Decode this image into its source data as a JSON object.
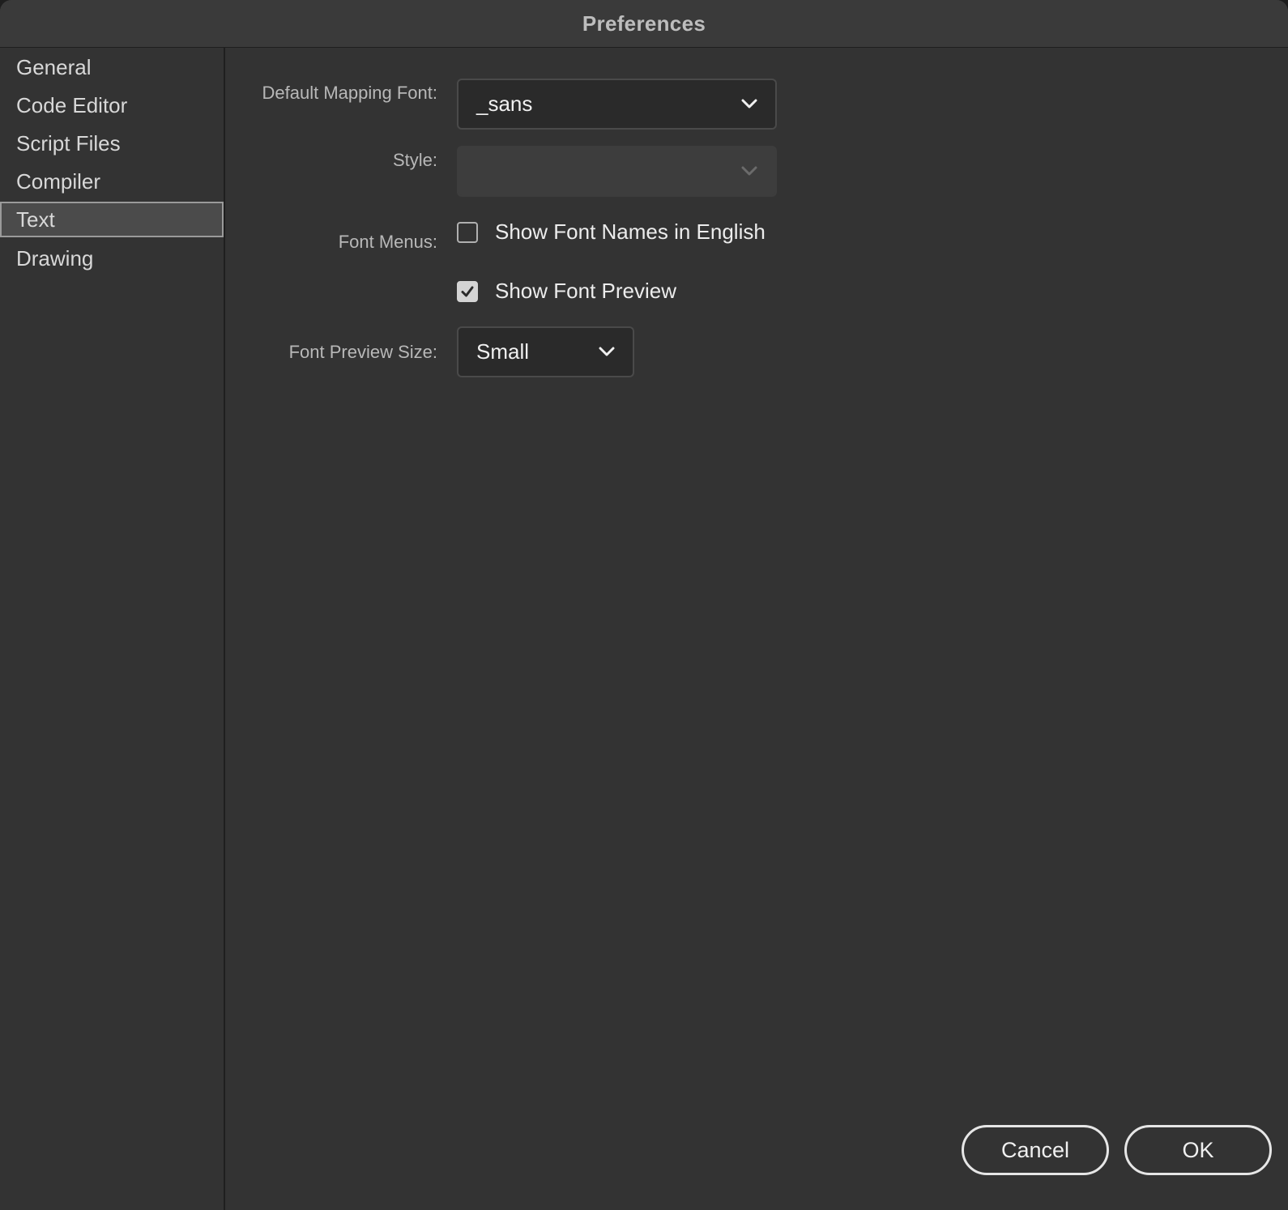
{
  "window": {
    "title": "Preferences"
  },
  "sidebar": {
    "items": [
      {
        "label": "General",
        "selected": false
      },
      {
        "label": "Code Editor",
        "selected": false
      },
      {
        "label": "Script Files",
        "selected": false
      },
      {
        "label": "Compiler",
        "selected": false
      },
      {
        "label": "Text",
        "selected": true
      },
      {
        "label": "Drawing",
        "selected": false
      }
    ]
  },
  "text_panel": {
    "default_mapping_font": {
      "label": "Default Mapping Font:",
      "value": "_sans"
    },
    "style": {
      "label": "Style:",
      "value": "",
      "disabled": true
    },
    "font_menus": {
      "label": "Font Menus:",
      "show_font_names_in_english": {
        "label": "Show Font Names in English",
        "checked": false
      },
      "show_font_preview": {
        "label": "Show Font Preview",
        "checked": true
      }
    },
    "font_preview_size": {
      "label": "Font Preview Size:",
      "value": "Small"
    }
  },
  "footer": {
    "cancel_label": "Cancel",
    "ok_label": "OK"
  },
  "icons": {
    "dropdown": "chevron-down-icon",
    "check": "checkmark-icon"
  },
  "colors": {
    "background": "#333333",
    "titlebar": "#3a3a3a",
    "selected_item": "#4b4b4b",
    "field": "#2a2a2a"
  }
}
